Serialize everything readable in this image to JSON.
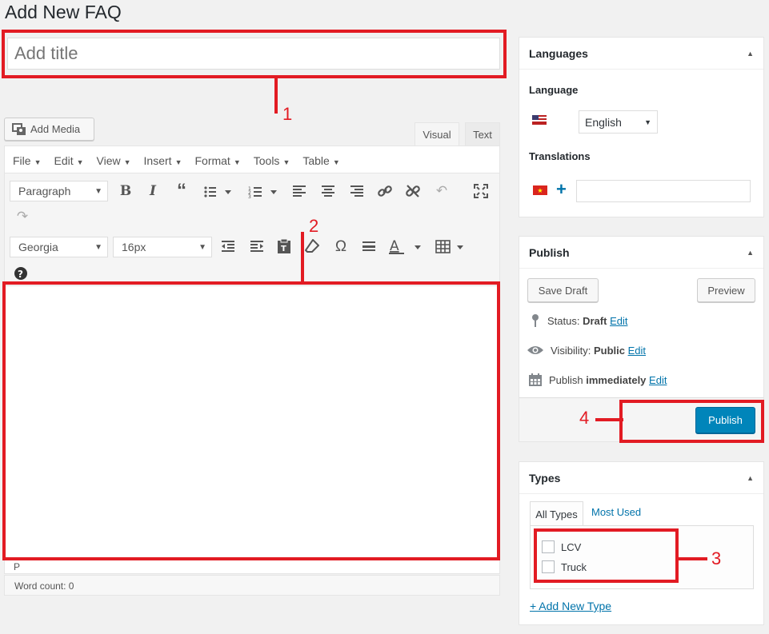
{
  "page": {
    "title": "Add New FAQ"
  },
  "title_field": {
    "placeholder": "Add title"
  },
  "editor": {
    "add_media": "Add Media",
    "tabs": {
      "visual": "Visual",
      "text": "Text"
    },
    "menu": [
      "File",
      "Edit",
      "View",
      "Insert",
      "Format",
      "Tools",
      "Table"
    ],
    "format_select": "Paragraph",
    "font_select": "Georgia",
    "size_select": "16px",
    "status_path": "P",
    "word_count": "Word count: 0"
  },
  "callouts": {
    "one": "1",
    "two": "2",
    "three": "3",
    "four": "4"
  },
  "languages": {
    "title": "Languages",
    "language_label": "Language",
    "language_value": "English",
    "translations_label": "Translations",
    "add_symbol": "+"
  },
  "publish": {
    "title": "Publish",
    "save_draft": "Save Draft",
    "preview": "Preview",
    "status_label": "Status:",
    "status_value": "Draft",
    "visibility_label": "Visibility:",
    "visibility_value": "Public",
    "publish_label": "Publish",
    "publish_when": "immediately",
    "edit": "Edit",
    "publish_button": "Publish"
  },
  "types": {
    "title": "Types",
    "tab_all": "All Types",
    "tab_most_used": "Most Used",
    "items": [
      "LCV",
      "Truck"
    ],
    "add_new": "+ Add New Type"
  },
  "colors": {
    "accent": "#0085ba",
    "callout": "#e21b23",
    "link": "#0073aa"
  }
}
